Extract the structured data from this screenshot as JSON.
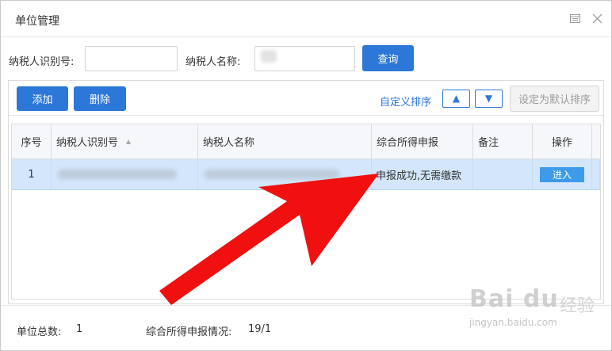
{
  "window": {
    "title": "单位管理"
  },
  "search": {
    "tax_no_label": "纳税人识别号:",
    "tax_no_value": "",
    "tax_name_label": "纳税人名称:",
    "tax_name_value": "",
    "query_label": "查询"
  },
  "toolbar": {
    "add_label": "添加",
    "delete_label": "删除",
    "custom_sort_label": "自定义排序",
    "up_label": "▲",
    "down_label": "▼",
    "set_default_label": "设定为默认排序"
  },
  "table": {
    "columns": [
      "序号",
      "纳税人识别号",
      "纳税人名称",
      "综合所得申报",
      "备注",
      "操作"
    ],
    "rows": [
      {
        "index": "1",
        "status": "申报成功,无需缴款",
        "remark": "",
        "action_label": "进入"
      }
    ]
  },
  "footer": {
    "unit_total_label": "单位总数:",
    "unit_total_value": "1",
    "declare_label": "综合所得申报情况:",
    "declare_value": "19/1"
  },
  "watermark": {
    "logo": "Bai du",
    "jingyan": "经验",
    "url": "jingyan.baidu.com"
  },
  "colors": {
    "primary": "#2d77d8",
    "selected_row": "#d3e6fb",
    "annotation_arrow": "#f01010",
    "enter_button": "#3d9be9"
  }
}
